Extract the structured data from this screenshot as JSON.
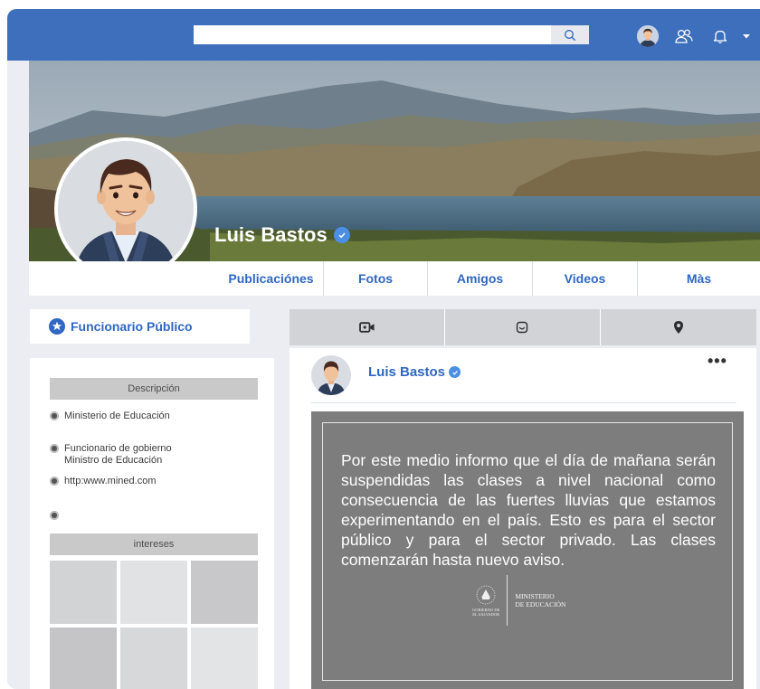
{
  "search": {
    "placeholder": "",
    "button_icon": "search-icon"
  },
  "nav": {
    "icons": [
      "avatar",
      "friends-icon",
      "bell-icon",
      "caret-down-icon"
    ]
  },
  "profile": {
    "name": "Luis Bastos",
    "tabs": [
      "Publicaciónes",
      "Fotos",
      "Amigos",
      "Videos",
      "Màs"
    ]
  },
  "sidebar": {
    "role": "Funcionario Público",
    "description_header": "Descripción",
    "info": [
      "Ministerio de Educación",
      "Funcionario de gobierno",
      "Ministro de Educación",
      "http:www.mined.com",
      ""
    ],
    "interests_header": "intereses",
    "interest_colors": [
      "#d2d3d5",
      "#e1e2e4",
      "#c8c7c9",
      "#c5c4c6",
      "#d6d8da",
      "#e3e4e5"
    ]
  },
  "composer": {
    "icons": [
      "video-camera-icon",
      "emoji-icon",
      "location-pin-icon"
    ]
  },
  "post": {
    "author": "Luis Bastos",
    "menu": "•••",
    "text": "Por este medio informo que el día de mañana serán suspendidas las clases a nivel nacional como consecuencia de las fuertes lluvias que estamos experimentando en el país. Esto es para el sector público y para el sector privado. Las clases comenzarán hasta nuevo aviso.",
    "logo_ministry_line1": "MINISTERIO",
    "logo_ministry_line2": "DE EDUCACIÓN",
    "logo_gov_line1": "GOBIERNO DE",
    "logo_gov_line2": "EL SALVADOR"
  },
  "colors": {
    "brand": "#3d6fbd",
    "accent_text": "#2f67c2",
    "verified": "#4a8ee6"
  }
}
